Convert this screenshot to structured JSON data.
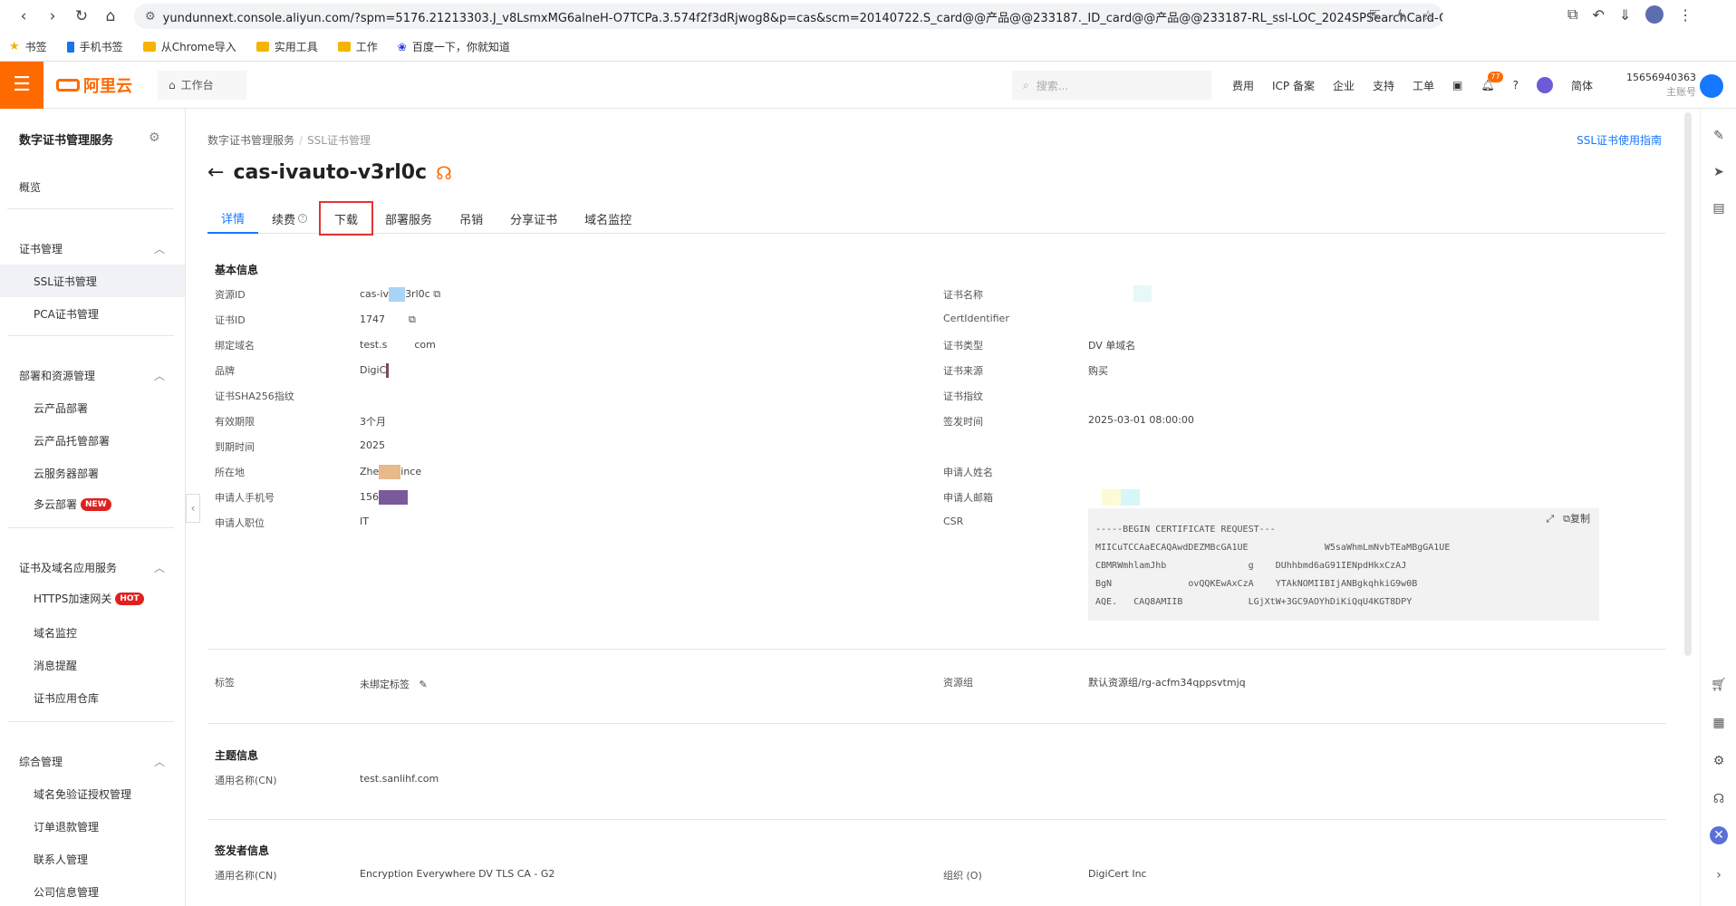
{
  "browser": {
    "url": "yundunnext.console.aliyun.com/?spm=5176.21213303.J_v8LsmxMG6alneH-O7TCPa.3.574f2f3dRjwog8&p=cas&scm=20140722.S_card@@产品@@233187._ID_card@@产品@@233187-RL_ssl-LOC_2024SPSearchCard-OR_ser-PAR1_213e36a01740813...",
    "bookmarks": [
      "书签",
      "手机书签",
      "从Chrome导入",
      "实用工具",
      "工作",
      "百度一下，你就知道"
    ]
  },
  "header": {
    "logo": "阿里云",
    "workbench": "工作台",
    "search_placeholder": "搜索...",
    "links": [
      "费用",
      "ICP 备案",
      "企业",
      "支持",
      "工单"
    ],
    "notify_count": "77",
    "lang": "简体",
    "account": "15656940363",
    "account_sub": "主账号"
  },
  "sidebar": {
    "title": "数字证书管理服务",
    "overview": "概览",
    "groups": [
      {
        "label": "证书管理",
        "items": [
          "SSL证书管理",
          "PCA证书管理"
        ]
      },
      {
        "label": "部署和资源管理",
        "items": [
          "云产品部署",
          "云产品托管部署",
          "云服务器部署",
          "多云部署"
        ]
      },
      {
        "label": "证书及域名应用服务",
        "items": [
          "HTTPS加速网关",
          "域名监控",
          "消息提醒",
          "证书应用仓库"
        ]
      },
      {
        "label": "综合管理",
        "items": [
          "域名免验证授权管理",
          "订单退款管理",
          "联系人管理",
          "公司信息管理"
        ]
      }
    ],
    "tag_new": "NEW",
    "tag_hot": "HOT"
  },
  "main": {
    "breadcrumb": [
      "数字证书管理服务",
      "SSL证书管理"
    ],
    "guide": "SSL证书使用指南",
    "title": "cas-ivauto-v3rl0c",
    "tabs": [
      "详情",
      "续费",
      "下载",
      "部署服务",
      "吊销",
      "分享证书",
      "域名监控"
    ],
    "basic": {
      "title": "基本信息",
      "left_labels": [
        "资源ID",
        "证书ID",
        "绑定域名",
        "品牌",
        "证书SHA256指纹",
        "有效期限",
        "到期时间",
        "所在地",
        "申请人手机号",
        "申请人职位"
      ],
      "left_values": [
        "cas-iv",
        "3rl0c",
        "1747",
        "test.s",
        "com",
        "DigiC",
        "",
        "3个月",
        "2025",
        "Zhe",
        "ince",
        "156",
        "IT"
      ],
      "right_labels": [
        "证书名称",
        "CertIdentifier",
        "证书类型",
        "证书来源",
        "证书指纹",
        "签发时间",
        "申请人姓名",
        "申请人邮箱",
        "CSR"
      ],
      "right_values": [
        "",
        "",
        "DV 单域名",
        "购买",
        "",
        "2025-03-01 08:00:00",
        "",
        ""
      ],
      "csr_lines": [
        "-----BEGIN CERTIFICATE REQUEST---",
        "MIICuTCCAaECAQAwdDEZMBcGA1UE",
        "W5saWhmLmNvbTEaMBgGA1UE",
        "CBMRWmhlamJhb",
        "g",
        "DUhhbmd6aG91IENpdHkxCzAJ",
        "BgN",
        "ovQQKEwAxCzA",
        "YTAkNOMIIBIjANBgkqhkiG9w0B",
        "AQE.",
        "CAQ8AMIIB",
        "LGjXtW+3GC9AOYhDiKiQqU4KGT8DPY"
      ],
      "csr_tools": [
        "复制"
      ]
    },
    "tags": {
      "label": "标签",
      "value": "未绑定标签",
      "rg_label": "资源组",
      "rg_value": "默认资源组/rg-acfm34qppsvtmjq"
    },
    "subject": {
      "title": "主题信息",
      "cn_label": "通用名称(CN)",
      "cn_value": "test.sanlihf.com"
    },
    "issuer": {
      "title": "签发者信息",
      "cn_label": "通用名称(CN)",
      "cn_value": "Encryption Everywhere DV TLS CA - G2",
      "org_label": "组织 (O)",
      "org_value": "DigiCert Inc"
    }
  }
}
